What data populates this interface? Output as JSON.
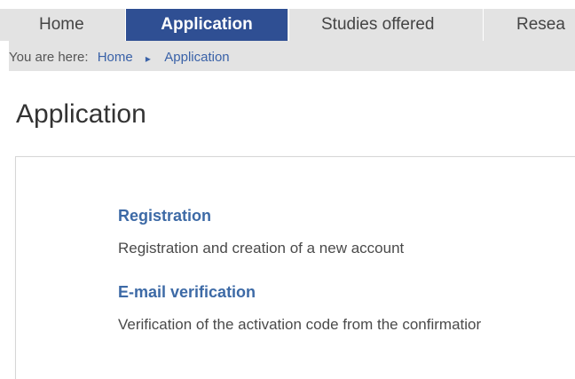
{
  "nav": {
    "items": [
      {
        "label": "Home",
        "active": false
      },
      {
        "label": "Application",
        "active": true
      },
      {
        "label": "Studies offered",
        "active": false
      },
      {
        "label": "Resea",
        "active": false
      }
    ]
  },
  "breadcrumb": {
    "prefix": "You are here:",
    "items": [
      "Home",
      "Application"
    ],
    "separator_icon": "chevron-right-icon"
  },
  "page": {
    "title": "Application"
  },
  "entries": [
    {
      "title": "Registration",
      "description": "Registration and creation of a new account"
    },
    {
      "title": "E-mail verification",
      "description": "Verification of the activation code from the confirmatior"
    }
  ],
  "colors": {
    "nav_active_bg": "#2f4f93",
    "nav_bg": "#e3e3e3",
    "link": "#3d6aa6"
  }
}
